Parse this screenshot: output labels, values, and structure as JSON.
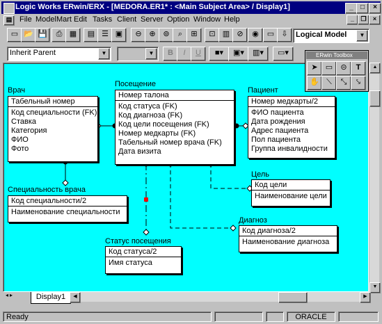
{
  "window": {
    "title": "Logic Works ERwin/ERX - [MEDORA.ER1* : <Main Subject Area> / Display1]"
  },
  "menu": [
    "File",
    "ModelMart",
    "Edit",
    "Tasks",
    "Client",
    "Server",
    "Option",
    "Window",
    "Help"
  ],
  "toolbar": {
    "model_view": "Logical Model",
    "font_combo": "Inherit Parent",
    "size_combo": "",
    "bold_label": "B",
    "italic_label": "I",
    "underline_label": "U"
  },
  "toolbox": {
    "title": "ERwin Toolbox"
  },
  "entities": {
    "vrach": {
      "name": "Врач",
      "key": [
        "Табельный номер"
      ],
      "attrs": [
        "Код специальности (FK)",
        "Ставка",
        "Категория",
        "ФИО",
        "Фото"
      ]
    },
    "poseshenie": {
      "name": "Посещение",
      "key": [
        "Номер талона"
      ],
      "attrs": [
        "Код статуса (FK)",
        "Код диагноза (FK)",
        "Код цели посещения (FK)",
        "Номер медкарты (FK)",
        "Табельный номер врача (FK)",
        "Дата визита"
      ]
    },
    "pacient": {
      "name": "Пациент",
      "key": [
        "Номер медкарты/2"
      ],
      "attrs": [
        "ФИО пациента",
        "Дата рождения",
        "Адрес пациента",
        "Пол пациента",
        "Группа инвалидности"
      ]
    },
    "cel": {
      "name": "Цель",
      "key": [
        "Код цели"
      ],
      "attrs": [
        "Наименование цели"
      ]
    },
    "specialnost": {
      "name": "Специальность врача",
      "key": [
        "Код специальности/2"
      ],
      "attrs": [
        "Наименование специальности"
      ]
    },
    "diagnoz": {
      "name": "Диагноз",
      "key": [
        "Код диагноза/2"
      ],
      "attrs": [
        "Наименование диагноза"
      ]
    },
    "status": {
      "name": "Статус посещения",
      "key": [
        "Код статуса/2"
      ],
      "attrs": [
        "Имя статуса"
      ]
    }
  },
  "tabs": {
    "active": "Display1"
  },
  "status": {
    "left": "Ready",
    "db": "ORACLE"
  },
  "colors": {
    "titlebar": "#000080",
    "canvas": "#00ffff",
    "face": "#c0c0c0"
  }
}
